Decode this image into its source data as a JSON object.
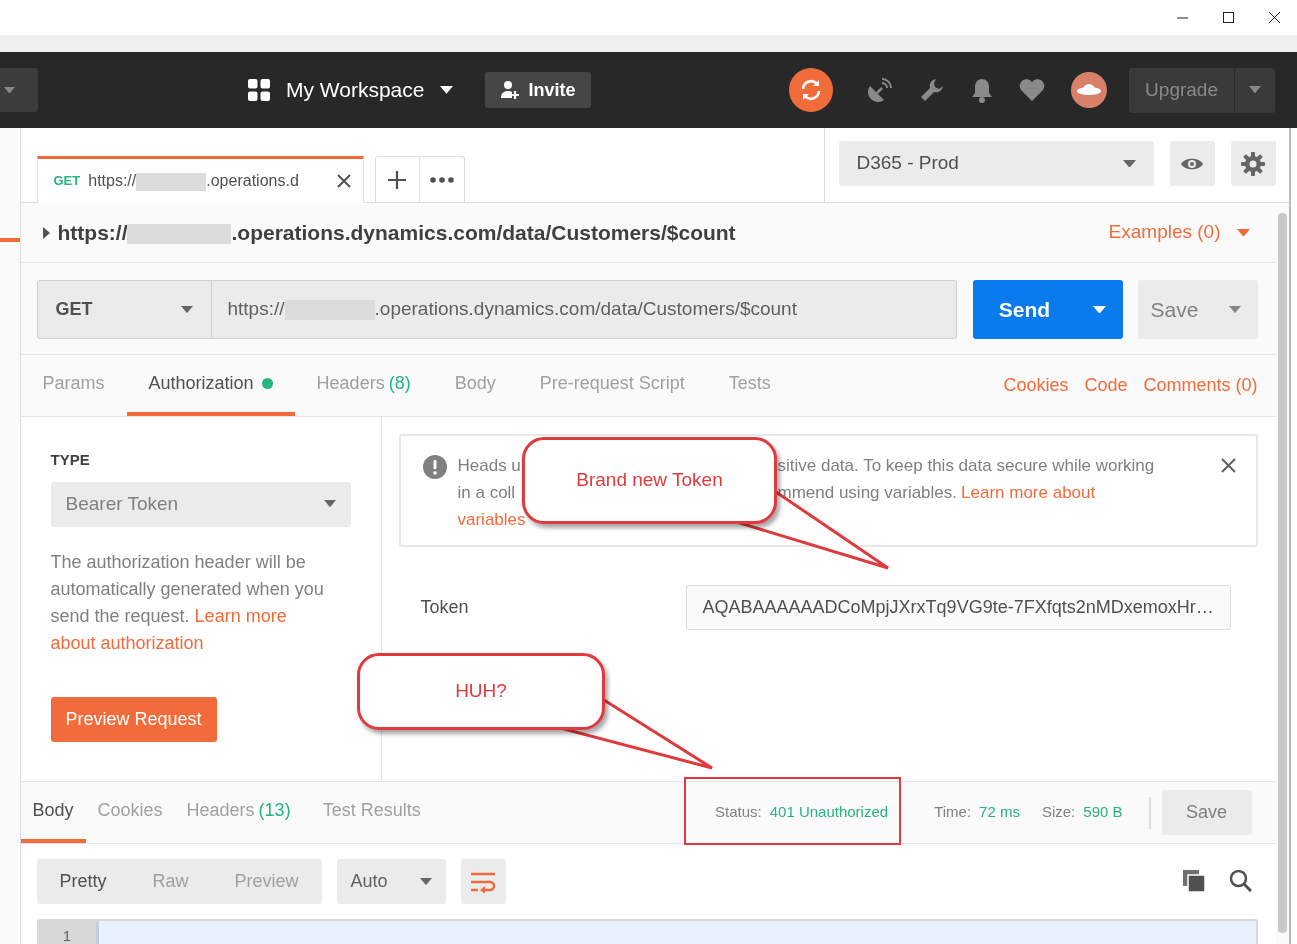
{
  "header": {
    "workspace": "My Workspace",
    "invite": "Invite",
    "upgrade": "Upgrade"
  },
  "request_tab": {
    "method": "GET",
    "url_start": "https://",
    "url_end": ".operations.d",
    "selected": true
  },
  "environment": "D365 - Prod",
  "request_name": {
    "url_start": "https://",
    "url_end": ".operations.dynamics.com/data/Customers/$count",
    "examples": "Examples (0)"
  },
  "request": {
    "method": "GET",
    "url_start": "https://",
    "url_end": ".operations.dynamics.com/data/Customers/$count",
    "send": "Send",
    "save": "Save"
  },
  "request_tabs": [
    {
      "label": "Params",
      "selected": false,
      "status_dot": false
    },
    {
      "label": "Authorization",
      "selected": true,
      "status_dot": true
    },
    {
      "label": "Headers",
      "count": "(8)",
      "selected": false,
      "status_dot": false
    },
    {
      "label": "Body",
      "selected": false,
      "status_dot": false
    },
    {
      "label": "Pre-request Script",
      "selected": false,
      "status_dot": false
    },
    {
      "label": "Tests",
      "selected": false,
      "status_dot": false
    }
  ],
  "request_links": [
    "Cookies",
    "Code",
    "Comments (0)"
  ],
  "auth": {
    "type_label": "TYPE",
    "type": "Bearer Token",
    "description": "The authorization header will be automatically generated when you send the request. ",
    "description_links": [
      "Learn more",
      "about authorization"
    ],
    "preview": "Preview Request",
    "token_label": "Token",
    "token": "AQABAAAAAADCoMpjJXrxTq9VG9te-7FXfqts2nMDxemoxHr…"
  },
  "alert": {
    "lines": [
      {
        "left": [
          {
            "kind": "text",
            "text": "Heads u"
          }
        ],
        "right": [
          {
            "kind": "text",
            "text": "sitive data. To keep this data secure while working"
          }
        ]
      },
      {
        "left": [
          {
            "kind": "text",
            "text": "in a coll"
          }
        ],
        "right": [
          {
            "kind": "text",
            "text": "mmend using variables."
          },
          {
            "kind": "link",
            "text": "Learn more about"
          }
        ]
      },
      {
        "left": [
          {
            "kind": "link",
            "text": "variables"
          }
        ]
      }
    ]
  },
  "response": {
    "tabs": [
      {
        "label": "Body",
        "selected": true
      },
      {
        "label": "Cookies",
        "selected": false
      },
      {
        "label": "Headers",
        "count": "(13)",
        "selected": false
      },
      {
        "label": "Test Results",
        "selected": false
      }
    ],
    "status_label": "Status:",
    "status": "401 Unauthorized",
    "time_label": "Time:",
    "time": "72 ms",
    "size_label": "Size:",
    "size": "590 B",
    "save": "Save"
  },
  "body_view": {
    "modes": [
      {
        "label": "Pretty",
        "selected": true
      },
      {
        "label": "Raw",
        "selected": false
      },
      {
        "label": "Preview",
        "selected": false
      }
    ],
    "format": "Auto",
    "line_numbers": [
      "1"
    ]
  },
  "annotations": [
    {
      "text": "Brand new Token"
    },
    {
      "text": "HUH?"
    }
  ]
}
